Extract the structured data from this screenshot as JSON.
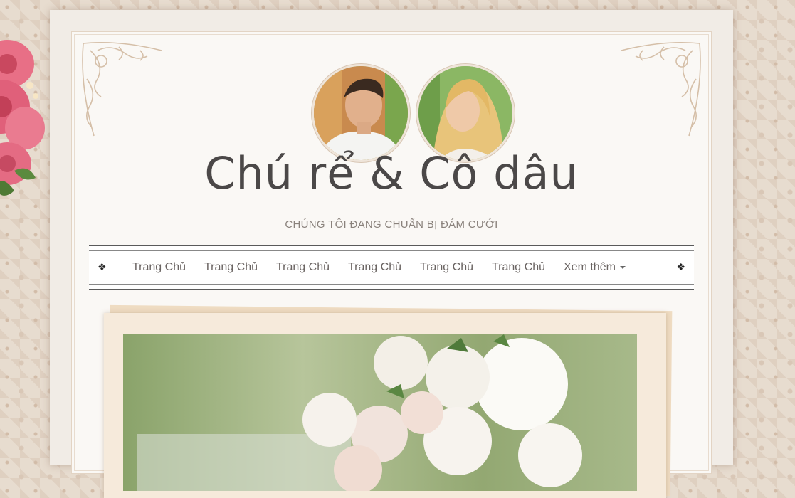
{
  "site": {
    "title": "Chú rể & Cô dâu",
    "tagline": "CHÚNG TÔI ĐANG CHUẨN BỊ ĐÁM CƯỚI"
  },
  "nav": {
    "items": [
      {
        "label": "Trang Chủ"
      },
      {
        "label": "Trang Chủ"
      },
      {
        "label": "Trang Chủ"
      },
      {
        "label": "Trang Chủ"
      },
      {
        "label": "Trang Chủ"
      },
      {
        "label": "Trang Chủ"
      }
    ],
    "more_label": "Xem thêm",
    "ornament": "❖"
  },
  "images": {
    "groom": "groom-portrait",
    "bride": "bride-portrait",
    "hero": "white-rose-bouquet-photo",
    "decor": "pink-roses-decoration"
  },
  "colors": {
    "title": "#4b4848",
    "tagline": "#8a827c",
    "nav_text": "#6a6462",
    "background": "#e7dccf"
  }
}
